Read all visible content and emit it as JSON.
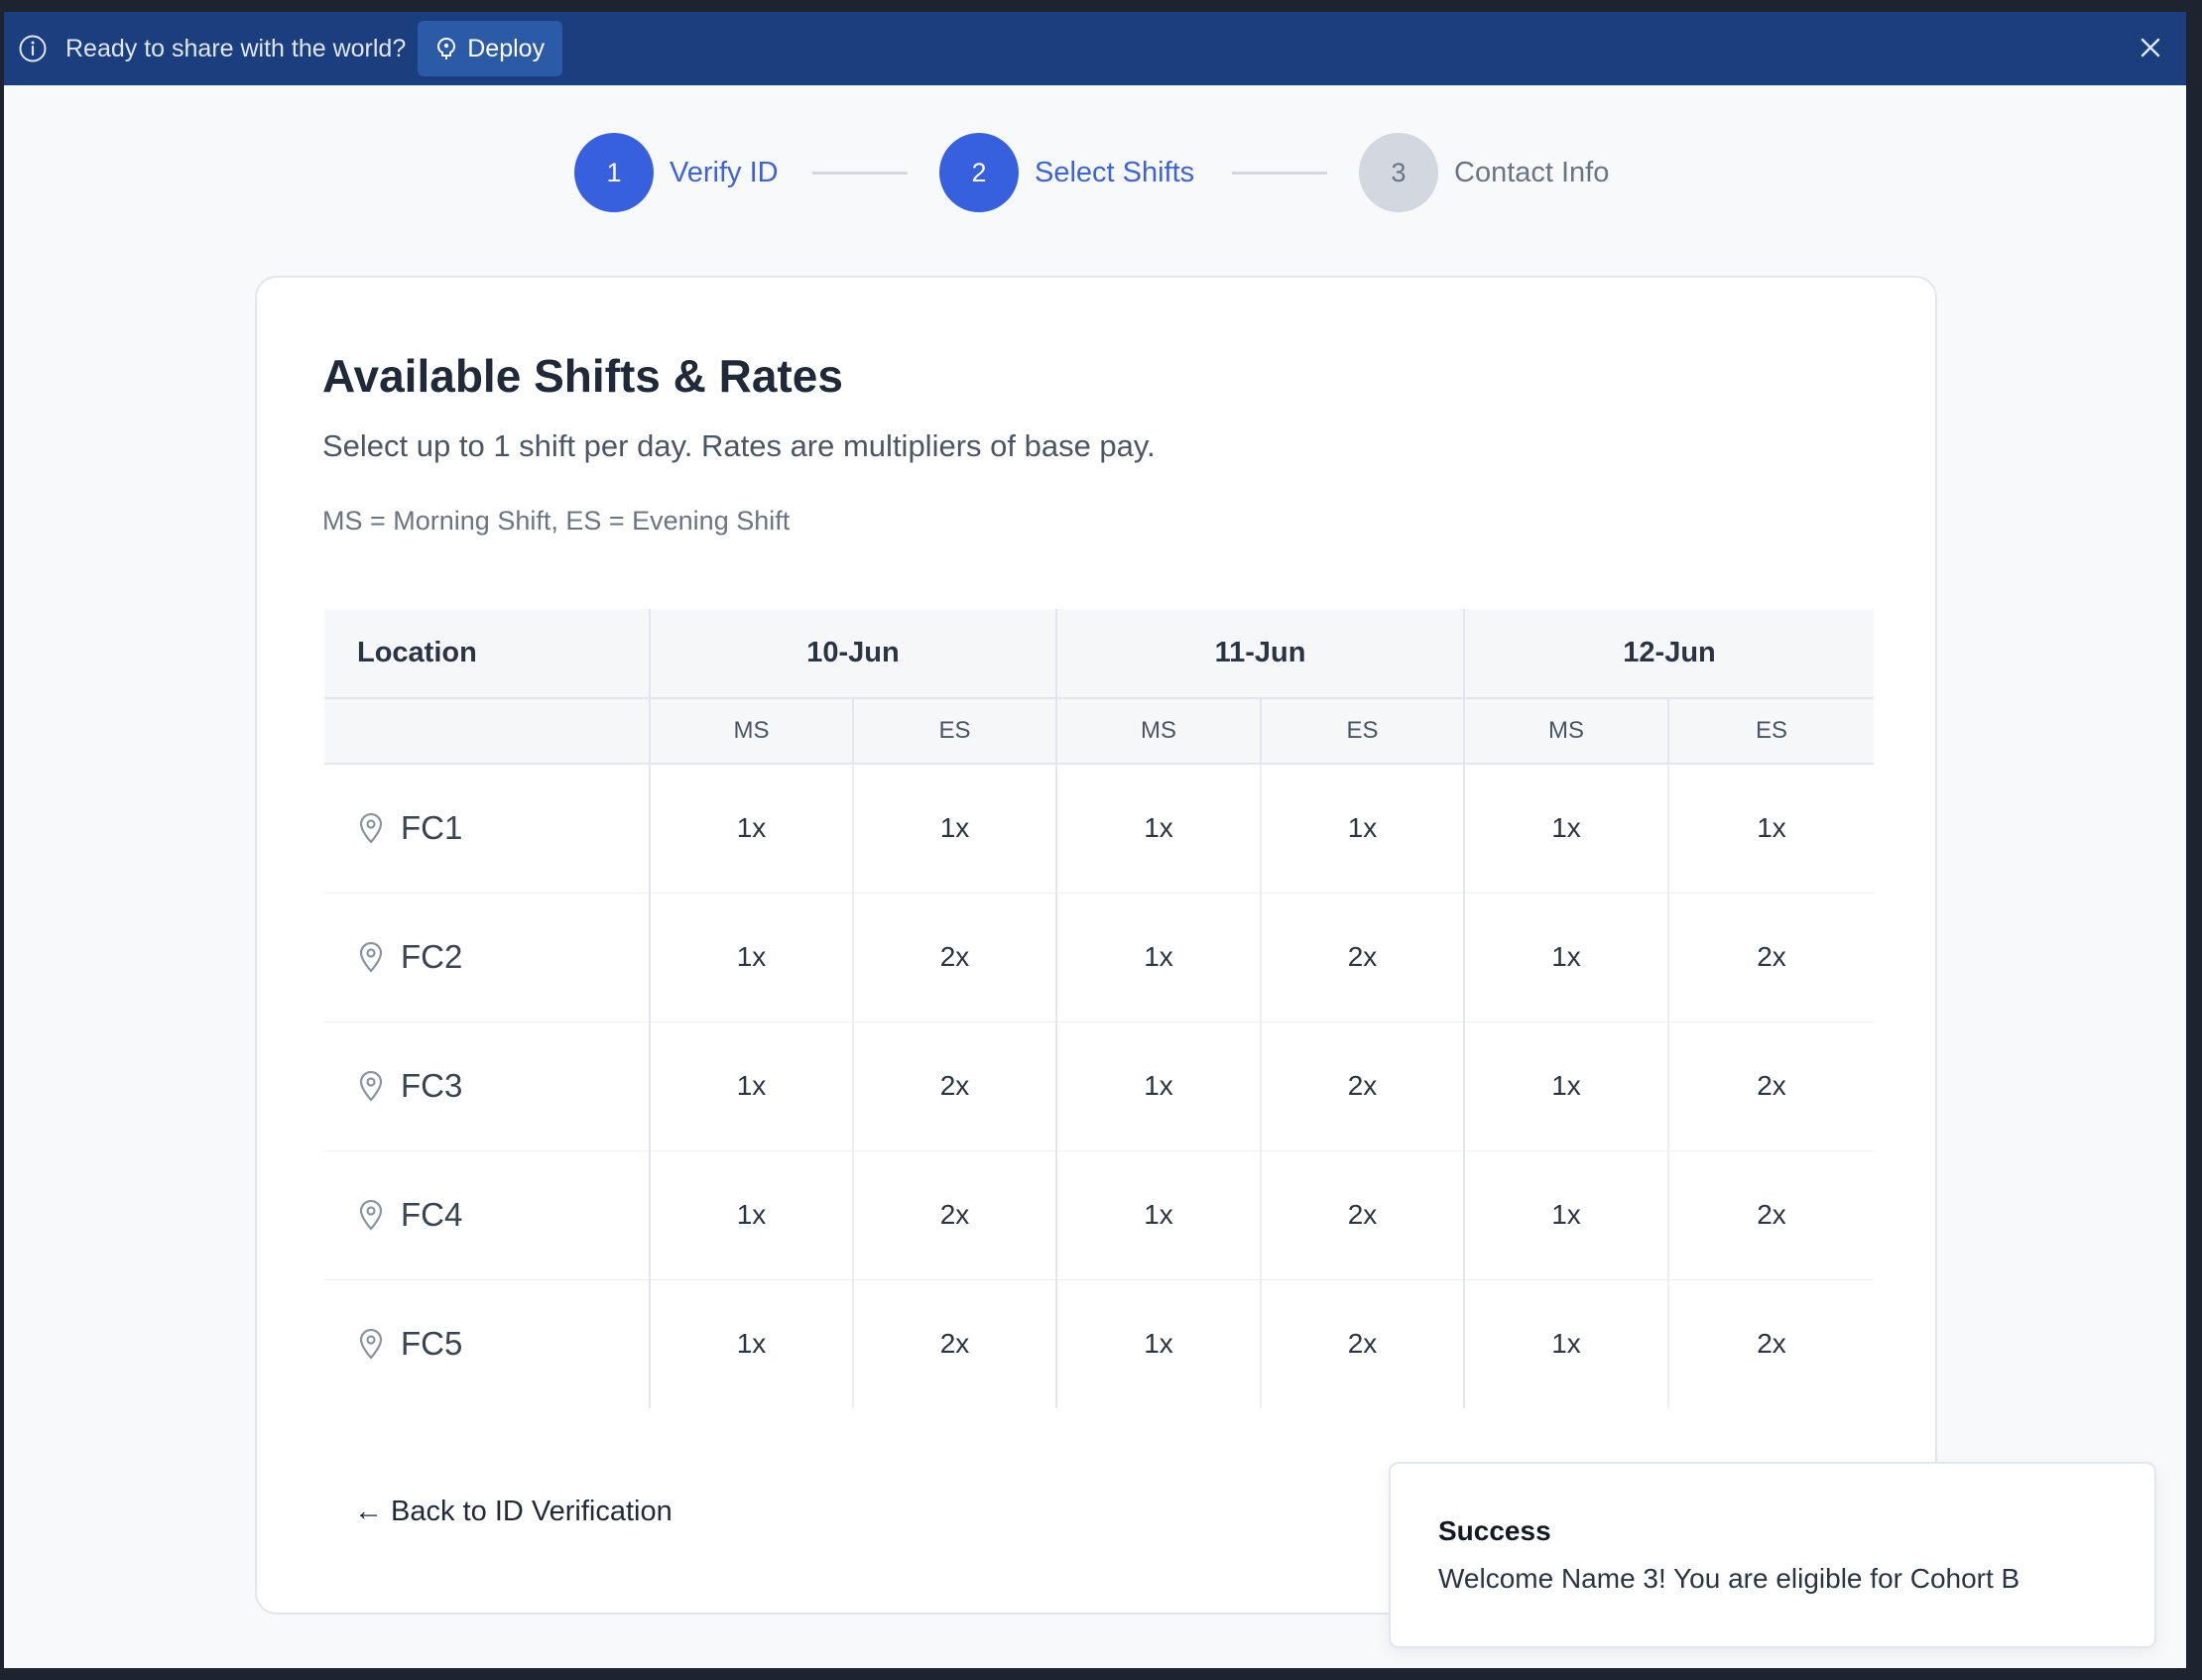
{
  "banner": {
    "text": "Ready to share with the world?",
    "deploy_label": "Deploy",
    "icons": {
      "info": "info-circle-icon",
      "deploy": "rocket-icon",
      "close": "close-icon"
    }
  },
  "stepper": {
    "steps": [
      {
        "number": "1",
        "label": "Verify ID",
        "state": "complete"
      },
      {
        "number": "2",
        "label": "Select Shifts",
        "state": "active"
      },
      {
        "number": "3",
        "label": "Contact Info",
        "state": "inactive"
      }
    ]
  },
  "card": {
    "title": "Available Shifts & Rates",
    "subtitle": "Select up to 1 shift per day. Rates are multipliers of base pay.",
    "legend_note": "MS = Morning Shift, ES = Evening Shift"
  },
  "table": {
    "location_header": "Location",
    "dates": [
      "10-Jun",
      "11-Jun",
      "12-Jun"
    ],
    "sub_headers": [
      "MS",
      "ES",
      "MS",
      "ES",
      "MS",
      "ES"
    ],
    "rows": [
      {
        "location": "FC1",
        "rates": [
          "1x",
          "1x",
          "1x",
          "1x",
          "1x",
          "1x"
        ]
      },
      {
        "location": "FC2",
        "rates": [
          "1x",
          "2x",
          "1x",
          "2x",
          "1x",
          "2x"
        ]
      },
      {
        "location": "FC3",
        "rates": [
          "1x",
          "2x",
          "1x",
          "2x",
          "1x",
          "2x"
        ]
      },
      {
        "location": "FC4",
        "rates": [
          "1x",
          "2x",
          "1x",
          "2x",
          "1x",
          "2x"
        ]
      },
      {
        "location": "FC5",
        "rates": [
          "1x",
          "2x",
          "1x",
          "2x",
          "1x",
          "2x"
        ]
      }
    ]
  },
  "back_link": "← Back to ID Verification",
  "toast": {
    "title": "Success",
    "message": "Welcome Name 3! You are eligible for Cohort B"
  },
  "colors": {
    "banner": "#1b3f7e",
    "accent": "#3760de",
    "inactive_step": "#d3d8e0"
  }
}
